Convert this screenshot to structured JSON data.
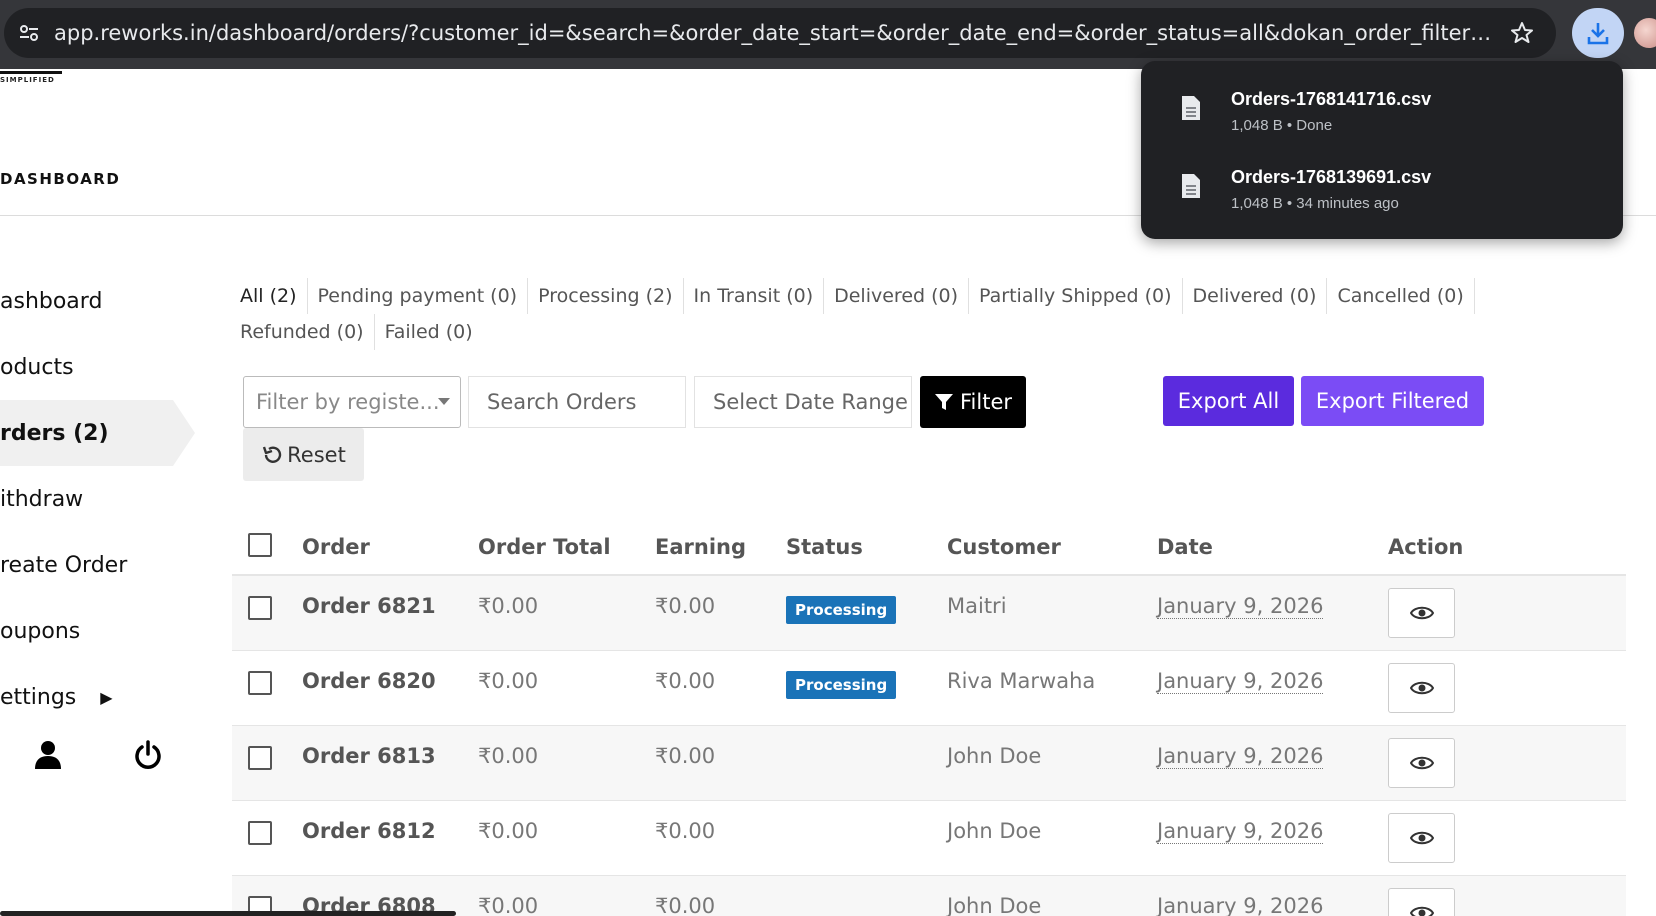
{
  "browser": {
    "url": "app.reworks.in/dashboard/orders/?customer_id=&search=&order_date_start=&order_date_end=&order_status=all&dokan_order_filter=&seller_order_filt..."
  },
  "downloads": [
    {
      "name": "Orders-1768141716.csv",
      "meta": "1,048 B • Done"
    },
    {
      "name": "Orders-1768139691.csv",
      "meta": "1,048 B • 34 minutes ago"
    }
  ],
  "logo": {
    "tagline": "SIMPLIFIED"
  },
  "header": {
    "title": "DASHBOARD"
  },
  "sidebar": {
    "items": [
      {
        "label": "ashboard"
      },
      {
        "label": "oducts"
      },
      {
        "label": "rders (2)"
      },
      {
        "label": "ithdraw"
      },
      {
        "label": "reate Order"
      },
      {
        "label": "oupons"
      },
      {
        "label": "ettings"
      }
    ],
    "settings_caret": "▶"
  },
  "status_tabs": [
    "All (2)",
    "Pending payment (0)",
    "Processing (2)",
    "In Transit (0)",
    "Delivered (0)",
    "Partially Shipped (0)",
    "Delivered (0)",
    "Cancelled (0)",
    "Refunded (0)",
    "Failed (0)"
  ],
  "toolbar": {
    "customer_filter_placeholder": "Filter by registe...",
    "search_placeholder": "Search Orders",
    "date_placeholder": "Select Date Range",
    "filter_label": "Filter",
    "export_all_label": "Export All",
    "export_filtered_label": "Export Filtered",
    "reset_label": "Reset"
  },
  "table": {
    "headers": {
      "order": "Order",
      "total": "Order Total",
      "earning": "Earning",
      "status": "Status",
      "customer": "Customer",
      "date": "Date",
      "action": "Action"
    },
    "rows": [
      {
        "order": "Order 6821",
        "total": "₹0.00",
        "earning": "₹0.00",
        "status": "Processing",
        "customer": "Maitri",
        "date": "January 9, 2026"
      },
      {
        "order": "Order 6820",
        "total": "₹0.00",
        "earning": "₹0.00",
        "status": "Processing",
        "customer": "Riva Marwaha",
        "date": "January 9, 2026"
      },
      {
        "order": "Order 6813",
        "total": "₹0.00",
        "earning": "₹0.00",
        "status": "",
        "customer": "John Doe",
        "date": "January 9, 2026"
      },
      {
        "order": "Order 6812",
        "total": "₹0.00",
        "earning": "₹0.00",
        "status": "",
        "customer": "John Doe",
        "date": "January 9, 2026"
      },
      {
        "order": "Order 6808",
        "total": "₹0.00",
        "earning": "₹0.00",
        "status": "",
        "customer": "John Doe",
        "date": "January 9, 2026"
      }
    ]
  },
  "colors": {
    "export_all": "#5b2bde",
    "export_filtered": "#7b4cf5",
    "status_processing": "#1a73b8",
    "filter_button": "#000000"
  }
}
